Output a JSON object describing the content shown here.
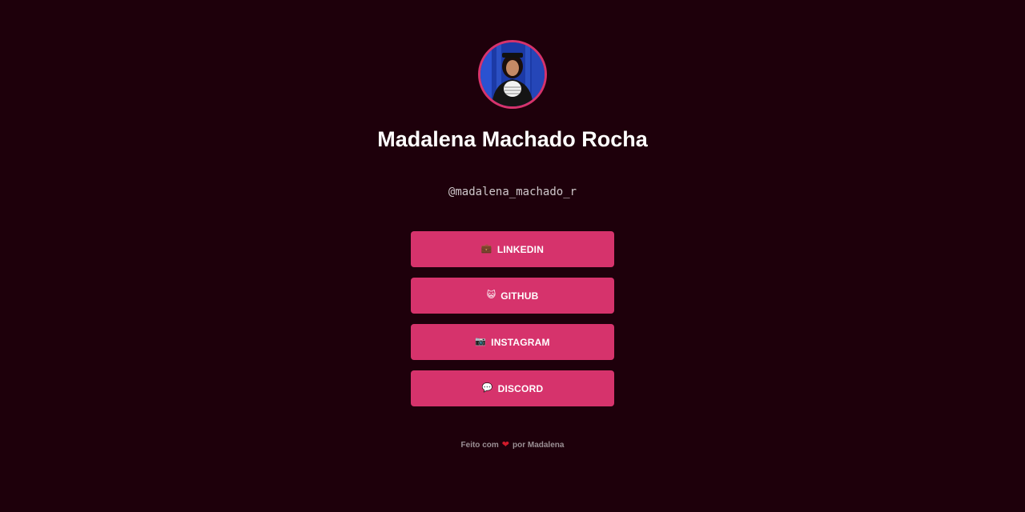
{
  "profile": {
    "name": "Madalena Machado Rocha",
    "handle": "@madalena_machado_r"
  },
  "links": [
    {
      "icon": "💼",
      "icon_name": "briefcase-icon",
      "label": "LINKEDIN"
    },
    {
      "icon": "😺",
      "icon_name": "cat-face-icon",
      "label": "GITHUB"
    },
    {
      "icon": "📷",
      "icon_name": "camera-icon",
      "label": "INSTAGRAM"
    },
    {
      "icon": "💬",
      "icon_name": "speech-bubble-icon",
      "label": "DISCORD"
    }
  ],
  "footer": {
    "prefix": "Feito com",
    "heart": "❤",
    "suffix": "por Madalena"
  },
  "colors": {
    "background": "#1e000b",
    "accent": "#d6336c",
    "heart": "#d11a2a"
  }
}
